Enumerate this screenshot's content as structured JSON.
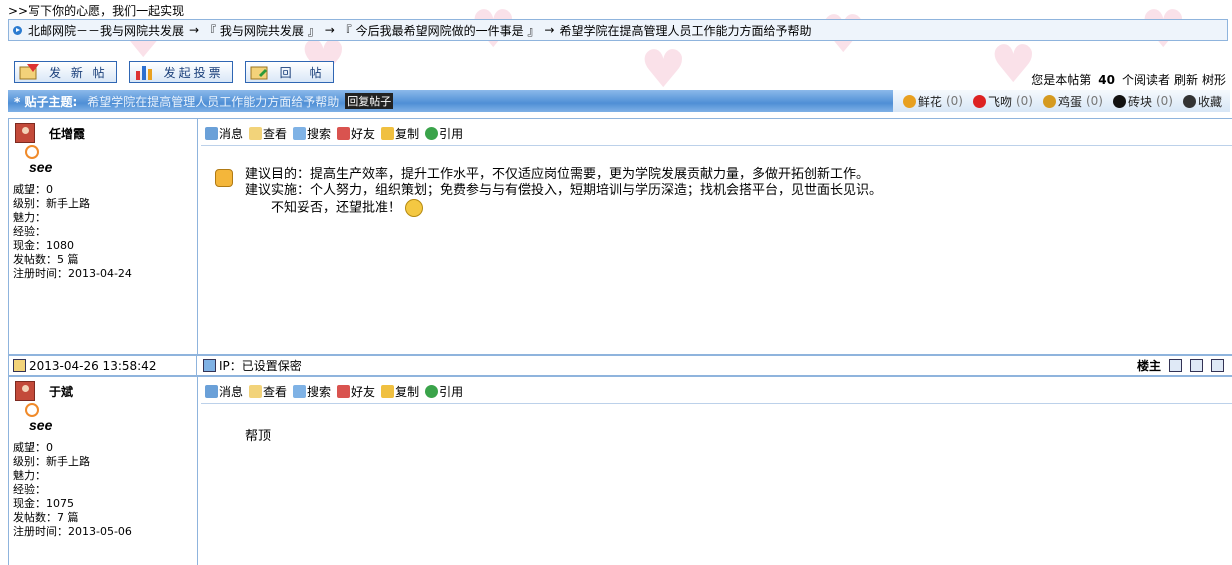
{
  "top_link": ">>写下你的心愿，我们一起实现",
  "breadcrumb": [
    "北邮网院－－我与网院共发展",
    "『 我与网院共发展 』",
    "『 今后我最希望网院做的一件事是 』",
    "希望学院在提高管理人员工作能力方面给予帮助"
  ],
  "breadcrumb_sep": "→",
  "buttons": {
    "new_post": "发 新 帖",
    "new_vote": "发起投票",
    "reply": "回　帖"
  },
  "read_info": {
    "prefix": "您是本帖第",
    "count": "40",
    "suffix": "个阅读者",
    "refresh": "刷新",
    "tree": "树形"
  },
  "topic": {
    "label": "* 贴子主题:",
    "title": "希望学院在提高管理人员工作能力方面给予帮助",
    "reply_tag": "回复帖子"
  },
  "reactions": [
    {
      "icon": "flower-icon",
      "label": "鲜花",
      "count": "(0)",
      "color": "#e8a020"
    },
    {
      "icon": "kiss-icon",
      "label": "飞吻",
      "count": "(0)",
      "color": "#d22"
    },
    {
      "icon": "egg-icon",
      "label": "鸡蛋",
      "count": "(0)",
      "color": "#d59a20"
    },
    {
      "icon": "bomb-icon",
      "label": "砖块",
      "count": "(0)",
      "color": "#111"
    },
    {
      "icon": "bookmark-icon",
      "label": "收藏",
      "count": "",
      "color": "#333"
    }
  ],
  "tools": [
    "消息",
    "查看",
    "搜索",
    "好友",
    "复制",
    "引用"
  ],
  "posts": [
    {
      "user": "任增霞",
      "see": "see",
      "stats": [
        "威望：0",
        "级别：新手上路",
        "魅力：",
        "经验：",
        "现金：1080",
        "发帖数：5 篇",
        "注册时间：2013-04-24"
      ],
      "content": [
        "建议目的：提高生产效率，提升工作水平，不仅适应岗位需要，更为学院发展贡献力量，多做开拓创新工作。",
        "建议实施：个人努力，组织策划；免费参与与有偿投入，短期培训与学历深造；找机会搭平台，见世面长见识。",
        "　　不知妥否，还望批准！"
      ]
    },
    {
      "user": "于斌",
      "see": "see",
      "stats": [
        "威望：0",
        "级别：新手上路",
        "魅力：",
        "经验：",
        "现金：1075",
        "发帖数：7 篇",
        "注册时间：2013-05-06"
      ],
      "content": [
        "帮顶"
      ]
    }
  ],
  "footer": {
    "date": "2013-04-26 13:58:42",
    "ip": "IP：已设置保密",
    "owner": "楼主"
  }
}
